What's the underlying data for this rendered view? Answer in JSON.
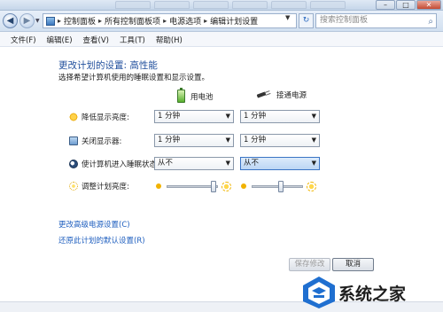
{
  "window": {
    "minimize": "–",
    "maximize": "□",
    "close": "✕"
  },
  "address_bar": {
    "crumbs": [
      "控制面板",
      "所有控制面板项",
      "电源选项",
      "编辑计划设置"
    ],
    "separator": "▸",
    "search_placeholder": "搜索控制面板"
  },
  "menu": [
    "文件(F)",
    "编辑(E)",
    "查看(V)",
    "工具(T)",
    "帮助(H)"
  ],
  "page": {
    "title": "更改计划的设置: 高性能",
    "description": "选择希望计算机使用的睡眠设置和显示设置。",
    "col_battery": "用电池",
    "col_plugged": "接通电源"
  },
  "settings": [
    {
      "label": "降低显示亮度:",
      "icon": "sun-icon",
      "battery": "1 分钟",
      "plugged": "1 分钟"
    },
    {
      "label": "关闭显示器:",
      "icon": "monitor-icon",
      "battery": "1 分钟",
      "plugged": "1 分钟"
    },
    {
      "label": "使计算机进入睡眠状态:",
      "icon": "moon-icon",
      "battery": "从不",
      "plugged": "从不"
    }
  ],
  "brightness": {
    "label": "调整计划亮度:",
    "battery_level": 0.95,
    "plugged_level": 0.55
  },
  "links": {
    "advanced": "更改高级电源设置(C)",
    "restore": "还原此计划的默认设置(R)"
  },
  "buttons": {
    "save": "保存修改",
    "cancel": "取消"
  },
  "watermark": {
    "text": "系统之家"
  },
  "colors": {
    "title_blue": "#1f4e9c",
    "link_blue": "#1f5fbf",
    "accent": "#3a74c4"
  }
}
